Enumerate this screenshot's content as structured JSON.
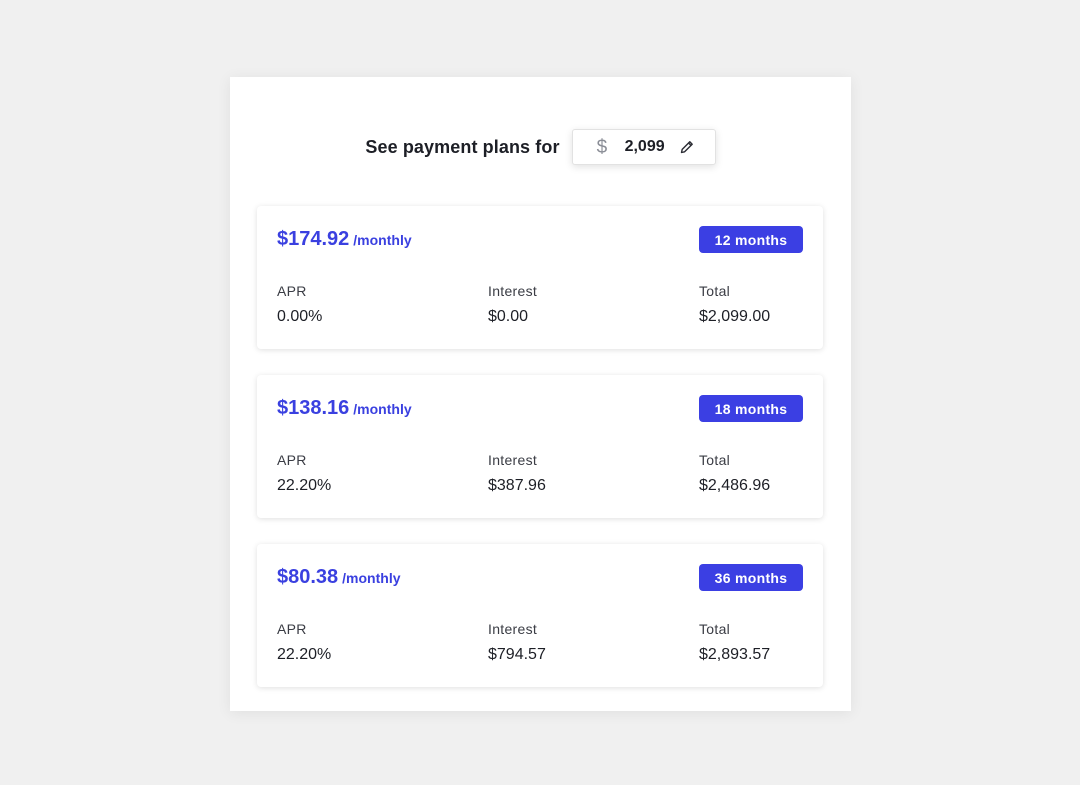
{
  "header": {
    "label": "See payment plans for",
    "currency_symbol": "$",
    "amount": "2,099",
    "edit_icon": "pencil-icon"
  },
  "colors": {
    "accent": "#3b3fe3",
    "background": "#f0f0f0",
    "panel": "#ffffff"
  },
  "plans": [
    {
      "monthly": "$174.92",
      "suffix": "/monthly",
      "term": "12 months",
      "apr_label": "APR",
      "apr": "0.00%",
      "interest_label": "Interest",
      "interest": "$0.00",
      "total_label": "Total",
      "total": "$2,099.00"
    },
    {
      "monthly": "$138.16",
      "suffix": "/monthly",
      "term": "18 months",
      "apr_label": "APR",
      "apr": "22.20%",
      "interest_label": "Interest",
      "interest": "$387.96",
      "total_label": "Total",
      "total": "$2,486.96"
    },
    {
      "monthly": "$80.38",
      "suffix": "/monthly",
      "term": "36 months",
      "apr_label": "APR",
      "apr": "22.20%",
      "interest_label": "Interest",
      "interest": "$794.57",
      "total_label": "Total",
      "total": "$2,893.57"
    }
  ]
}
